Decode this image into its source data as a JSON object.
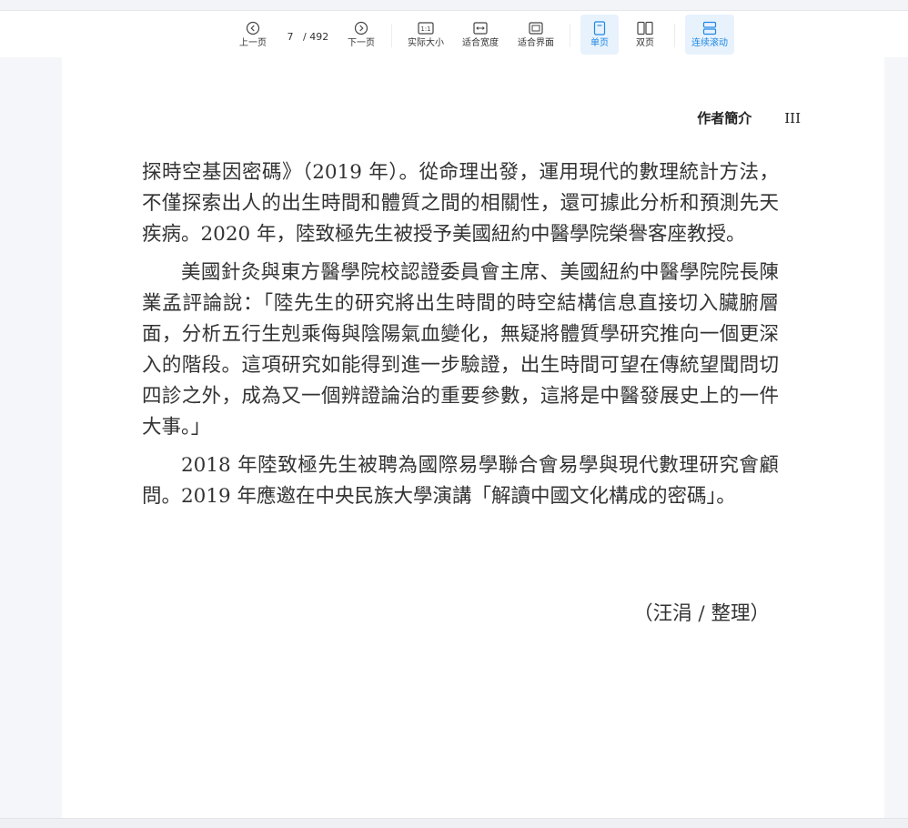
{
  "toolbar": {
    "prev_label": "上一页",
    "current_page": "7",
    "total_pages": "/ 492",
    "next_label": "下一页",
    "actual_size_label": "实际大小",
    "fit_width_label": "适合宽度",
    "fit_page_label": "适合界面",
    "single_page_label": "单页",
    "double_page_label": "双页",
    "continuous_scroll_label": "连续滚动",
    "actual_size_icon_text": "1:1"
  },
  "document": {
    "header_title": "作者簡介",
    "header_page_number": "III",
    "paragraphs": [
      "探時空基因密碼》（2019 年）。從命理出發，運用現代的數理統計方法，不僅探索出人的出生時間和體質之間的相關性，還可據此分析和預測先天疾病。2020 年，陸致極先生被授予美國紐約中醫學院榮譽客座教授。",
      "美國針灸與東方醫學院校認證委員會主席、美國紐約中醫學院院長陳業孟評論說：「陸先生的研究將出生時間的時空結構信息直接切入臟腑層面，分析五行生剋乘侮與陰陽氣血變化，無疑將體質學研究推向一個更深入的階段。這項研究如能得到進一步驗證，出生時間可望在傳統望聞問切四診之外，成為又一個辨證論治的重要參數，這將是中醫發展史上的一件大事。」",
      "2018 年陸致極先生被聘為國際易學聯合會易學與現代數理研究會顧問。2019 年應邀在中央民族大學演講「解讀中國文化構成的密碼」。"
    ],
    "signature": "（汪涓 / 整理）"
  },
  "colors": {
    "accent": "#1e88e5",
    "active_bg": "#e8f2fd"
  }
}
